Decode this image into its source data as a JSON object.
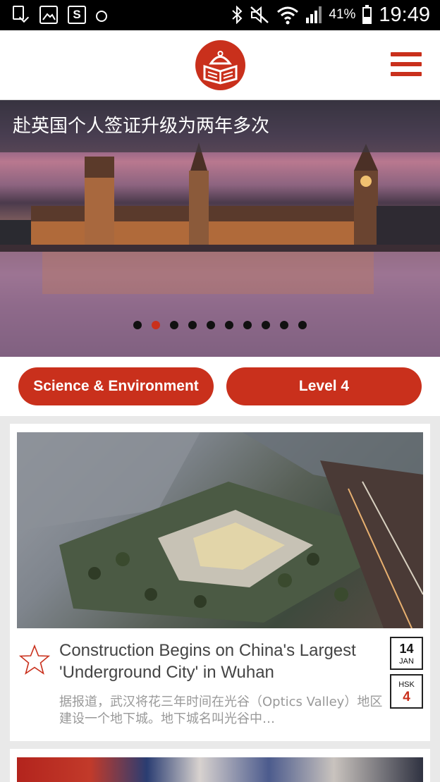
{
  "status_bar": {
    "battery_percent": "41%",
    "time": "19:49",
    "icons": [
      "download-icon",
      "image-icon",
      "s-app-icon",
      "sync-icon",
      "bluetooth-icon",
      "mute-icon",
      "wifi-icon",
      "signal-icon",
      "battery-icon"
    ],
    "s_app_glyph": "S",
    "battery_level": 0.41
  },
  "header": {
    "logo": "bao-logo-icon",
    "menu": "menu-icon"
  },
  "hero": {
    "title": "赴英国个人签证升级为两年多次",
    "slide_count": 10,
    "active_slide": 1
  },
  "tags": {
    "category": "Science & Environment",
    "level": "Level 4"
  },
  "article": {
    "title": "Construction Begins on China's Largest 'Underground City' in Wuhan",
    "snippet": "据报道，武汉将花三年时间在光谷（Optics Valley）地区建设一个地下城。地下城名叫光谷中…",
    "date_day": "14",
    "date_month": "JAN",
    "hsk_label": "HSK",
    "hsk_level": "4",
    "favorite": "star-icon"
  },
  "colors": {
    "accent": "#c9301c",
    "status_bar": "#000000",
    "background": "#e9e9e9"
  }
}
